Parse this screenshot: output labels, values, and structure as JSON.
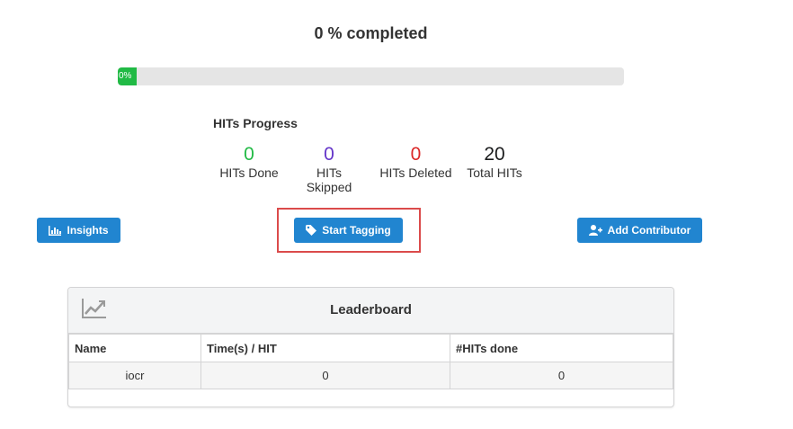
{
  "progress": {
    "title": "0 % completed",
    "percent": 0,
    "bar_label": "0%",
    "bar_color": "#21ba45"
  },
  "hits": {
    "title": "HITs Progress",
    "stats": [
      {
        "value": "0",
        "label": "HITs Done",
        "color": "#21ba45"
      },
      {
        "value": "0",
        "label": "HITs Skipped",
        "color": "#6435c9"
      },
      {
        "value": "0",
        "label": "HITs Deleted",
        "color": "#db2828"
      },
      {
        "value": "20",
        "label": "Total HITs",
        "color": "#1b1c1d"
      }
    ]
  },
  "buttons": {
    "insights": {
      "label": "Insights",
      "icon": "bar-chart-icon"
    },
    "start_tagging": {
      "label": "Start Tagging",
      "icon": "tag-icon"
    },
    "add_contributor": {
      "label": "Add Contributor",
      "icon": "add-user-icon"
    }
  },
  "accent_color": "#2185d0",
  "leaderboard": {
    "title": "Leaderboard",
    "icon": "line-chart-icon",
    "columns": [
      "Name",
      "Time(s) / HIT",
      "#HITs done"
    ],
    "rows": [
      {
        "name": "iocr",
        "time": "0",
        "hits_done": "0"
      }
    ]
  }
}
